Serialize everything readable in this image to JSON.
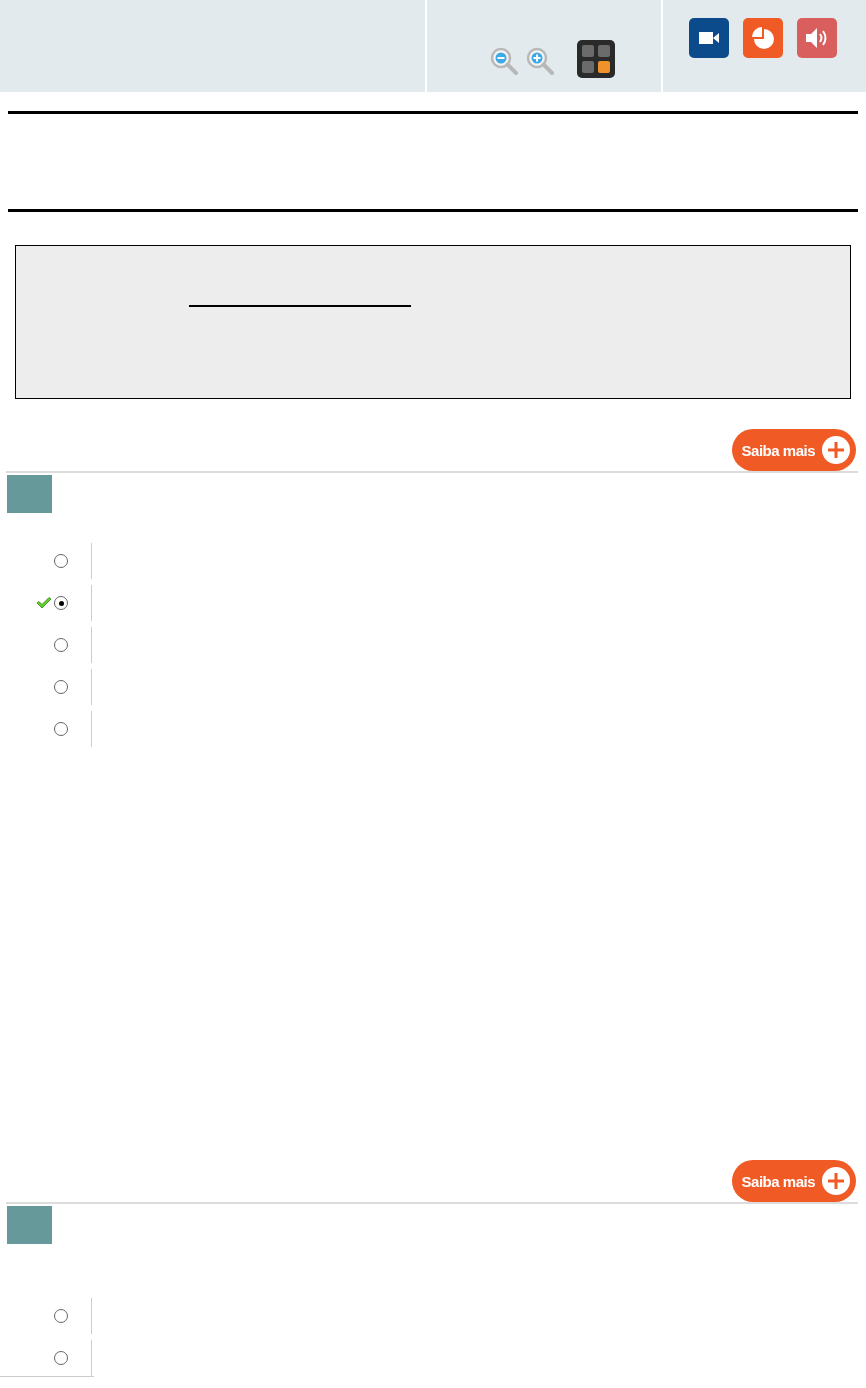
{
  "questions": [
    {
      "more_button": "Saiba mais",
      "options": [
        {
          "selected": false,
          "marked_correct": false
        },
        {
          "selected": true,
          "marked_correct": true
        },
        {
          "selected": false,
          "marked_correct": false
        },
        {
          "selected": false,
          "marked_correct": false
        },
        {
          "selected": false,
          "marked_correct": false
        }
      ]
    },
    {
      "more_button": "Saiba mais",
      "options": [
        {
          "selected": false,
          "marked_correct": false
        },
        {
          "selected": false,
          "marked_correct": false
        }
      ]
    }
  ]
}
